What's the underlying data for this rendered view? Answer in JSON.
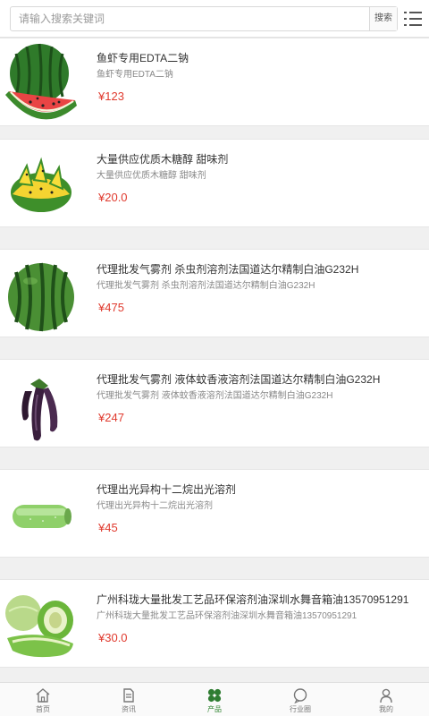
{
  "search": {
    "placeholder": "请输入搜索关键词",
    "button_label": "搜索",
    "menu_icon": "list-menu-icon"
  },
  "products": [
    {
      "title": "鱼虾专用EDTA二钠",
      "subtitle": "鱼虾专用EDTA二钠",
      "price": "¥123",
      "image": "watermelon-slice"
    },
    {
      "title": "大量供应优质木糖醇 甜味剂",
      "subtitle": "大量供应优质木糖醇 甜味剂",
      "price": "¥20.0",
      "image": "yellow-watermelon"
    },
    {
      "title": "代理批发气雾剂 杀虫剂溶剂法国道达尔精制白油G232H",
      "subtitle": "代理批发气雾剂 杀虫剂溶剂法国道达尔精制白油G232H",
      "price": "¥475",
      "image": "whole-watermelon"
    },
    {
      "title": "代理批发气雾剂 液体蚊香液溶剂法国道达尔精制白油G232H",
      "subtitle": "代理批发气雾剂 液体蚊香液溶剂法国道达尔精制白油G232H",
      "price": "¥247",
      "image": "eggplant"
    },
    {
      "title": "代理出光异构十二烷出光溶剂",
      "subtitle": "代理出光异构十二烷出光溶剂",
      "price": "¥45",
      "image": "winter-melon"
    },
    {
      "title": "广州科珑大量批发工艺品环保溶剂油深圳水舞音箱油13570951291",
      "subtitle": "广州科珑大量批发工艺品环保溶剂油深圳水舞音箱油13570951291",
      "price": "¥30.0",
      "image": "green-melon"
    }
  ],
  "nav": [
    {
      "label": "首页",
      "icon": "home-icon"
    },
    {
      "label": "资讯",
      "icon": "document-icon"
    },
    {
      "label": "产品",
      "icon": "clover-icon",
      "active": true
    },
    {
      "label": "行业圈",
      "icon": "chat-bubble-icon"
    },
    {
      "label": "我的",
      "icon": "user-icon"
    }
  ],
  "colors": {
    "price": "#e03a2e",
    "accent": "#3a8a3a"
  }
}
